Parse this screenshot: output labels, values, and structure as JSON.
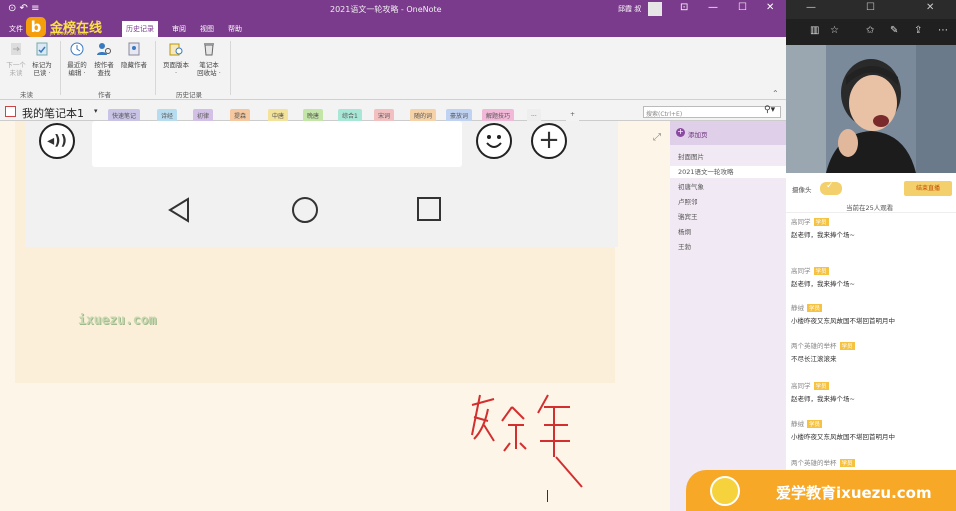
{
  "window": {
    "title": "2021语文一轮攻略 - OneNote",
    "user": "邱霞 叔",
    "controls": [
      "—",
      "☐",
      "✕"
    ]
  },
  "menu": {
    "file": "文件",
    "tabs": [
      "历史记录",
      "审阅",
      "视图",
      "帮助"
    ],
    "active": "历史记录"
  },
  "logo": {
    "text": "金榜在线",
    "sub": "JIN BANG ZAI XIAN",
    "letter": "b"
  },
  "ribbon": {
    "buttons": [
      {
        "label": "下一个\n未读",
        "id": "next-unread"
      },
      {
        "label": "标记为\n已读 ·",
        "id": "mark-read"
      },
      {
        "label": "最近的\n编辑 ·",
        "id": "recent-edits"
      },
      {
        "label": "按作者\n查找",
        "id": "find-author"
      },
      {
        "label": "隐藏作者",
        "id": "hide-authors"
      },
      {
        "label": "页面版本\n·",
        "id": "page-versions"
      },
      {
        "label": "笔记本\n回收站 ·",
        "id": "notebook-recycle"
      }
    ],
    "groups": [
      "未读",
      "作者",
      "历史记录"
    ]
  },
  "notebook": {
    "name": "我的笔记本1",
    "sections": [
      {
        "label": "快速笔记",
        "color": "#c9c3e6"
      },
      {
        "label": "诗经",
        "color": "#b7dcf0"
      },
      {
        "label": "初律",
        "color": "#d3c0e6"
      },
      {
        "label": "提森",
        "color": "#f6c8a0"
      },
      {
        "label": "中唐",
        "color": "#f2e29a"
      },
      {
        "label": "晚唐",
        "color": "#c3e6a8"
      },
      {
        "label": "综合1",
        "color": "#a8e6d6"
      },
      {
        "label": "宋词",
        "color": "#f2c0c0"
      },
      {
        "label": "随的词",
        "color": "#f6d2a8"
      },
      {
        "label": "豪放词",
        "color": "#c0d2f2"
      },
      {
        "label": "解题技巧",
        "color": "#f2b8d8"
      },
      {
        "label": "...",
        "color": "#eeeeee"
      },
      {
        "label": "+",
        "color": "#f3f3f3"
      }
    ],
    "search_placeholder": "搜索(Ctrl+E)"
  },
  "page": {
    "watermark": "ixuezu.com",
    "handwriting": "庆余年"
  },
  "pages": {
    "add": "添加页",
    "items": [
      "封面图片",
      "2021语文一轮攻略",
      "初唐气象",
      "卢照邻",
      "骆宾王",
      "杨炯",
      "王勃"
    ],
    "selected": 1
  },
  "live": {
    "camera_label": "摄像头",
    "end_button": "结束直播",
    "viewers": "当前在25人观看",
    "messages": [
      {
        "name": "高同学",
        "tag": "学员",
        "text": "赵老师，我来捧个场~"
      },
      {
        "name": "高同学",
        "tag": "学员",
        "text": "赵老师，我来捧个场~"
      },
      {
        "name": "静绒",
        "tag": "学员",
        "text": "小楼昨夜又东风故国不堪回首明月中"
      },
      {
        "name": "两个英雄的举杯",
        "tag": "学员",
        "text": "不尽长江滚滚来"
      },
      {
        "name": "高同学",
        "tag": "学员",
        "text": "赵老师，我来捧个场~"
      },
      {
        "name": "静绒",
        "tag": "学员",
        "text": "小楼昨夜又东风故国不堪回首明月中"
      },
      {
        "name": "两个英雄的举杯",
        "tag": "学员",
        "text": ""
      }
    ]
  },
  "brand": {
    "text": "爱学教育ixuezu.com"
  }
}
